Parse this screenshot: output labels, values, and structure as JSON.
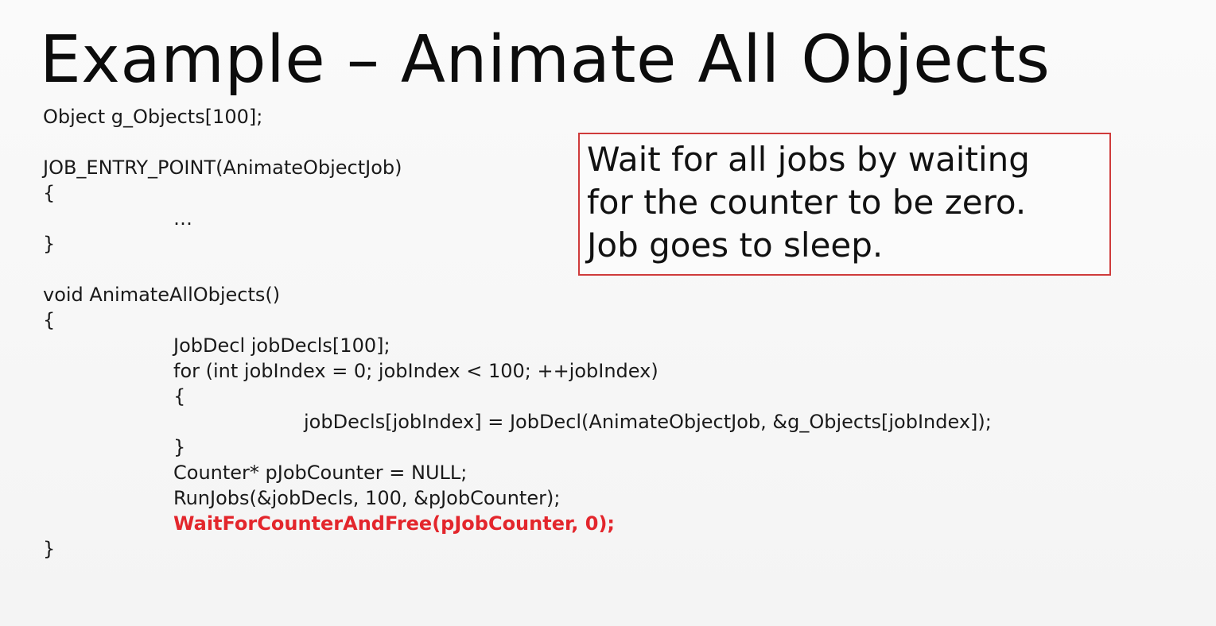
{
  "slide": {
    "title": "Example – Animate All Objects",
    "code_lines": [
      "Object g_Objects[100];",
      "JOB_ENTRY_POINT(AnimateObjectJob)",
      "{",
      "…",
      "}",
      "void AnimateAllObjects()",
      "{",
      "JobDecl jobDecls[100];",
      "for (int jobIndex = 0; jobIndex < 100; ++jobIndex)",
      "{",
      "jobDecls[jobIndex] = JobDecl(AnimateObjectJob, &g_Objects[jobIndex]);",
      "}",
      "Counter* pJobCounter = NULL;",
      "RunJobs(&jobDecls, 100, &pJobCounter);",
      "WaitForCounterAndFree(pJobCounter, 0);",
      "}"
    ],
    "callout_lines": [
      "Wait for all jobs by waiting",
      "for the counter to be zero.",
      "Job goes to sleep."
    ],
    "colors": {
      "highlight": "#e3262c",
      "callout_border": "#cf3b3b"
    }
  }
}
